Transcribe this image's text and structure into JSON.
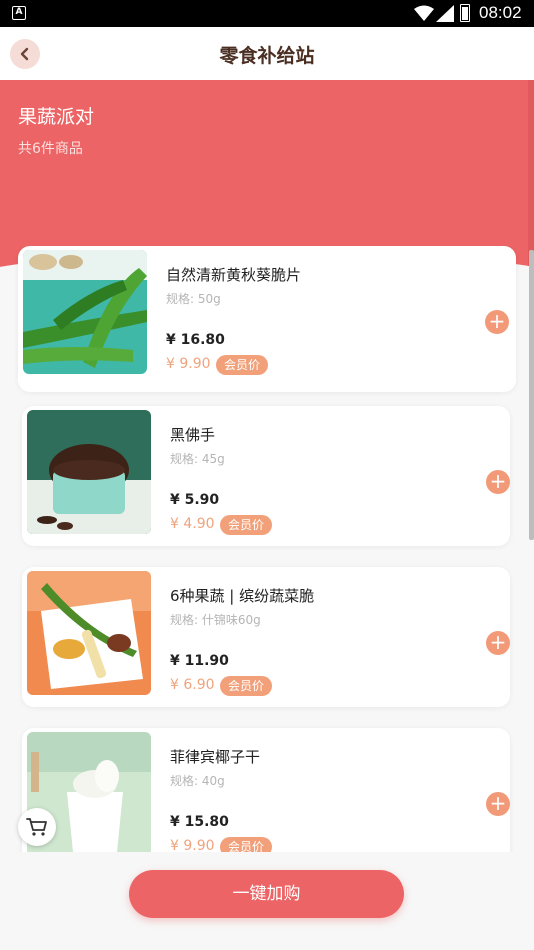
{
  "status_bar": {
    "time": "08:02",
    "app_indicator": "A"
  },
  "header": {
    "title": "零食补给站",
    "back_icon": "chevron-left-icon"
  },
  "banner": {
    "title": "果蔬派对",
    "subtitle": "共6件商品",
    "color": "#ec6465"
  },
  "products": [
    {
      "name": "自然清新黄秋葵脆片",
      "spec": "规格: 50g",
      "price": "¥ 16.80",
      "member_price": "¥ 9.90",
      "badge": "会员价"
    },
    {
      "name": "黑佛手",
      "spec": "规格: 45g",
      "price": "¥ 5.90",
      "member_price": "¥ 4.90",
      "badge": "会员价"
    },
    {
      "name": "6种果蔬 | 缤纷蔬菜脆",
      "spec": "规格: 什锦味60g",
      "price": "¥ 11.90",
      "member_price": "¥ 6.90",
      "badge": "会员价"
    },
    {
      "name": "菲律宾椰子干",
      "spec": "规格: 40g",
      "price": "¥ 15.80",
      "member_price": "¥ 9.90",
      "badge": "会员价"
    }
  ],
  "actions": {
    "one_click_add": "一键加购",
    "add_icon": "plus-icon",
    "cart_icon": "cart-icon"
  },
  "colors": {
    "accent": "#ec6465",
    "badge": "#f2a07a",
    "member_price": "#f0a37c"
  }
}
